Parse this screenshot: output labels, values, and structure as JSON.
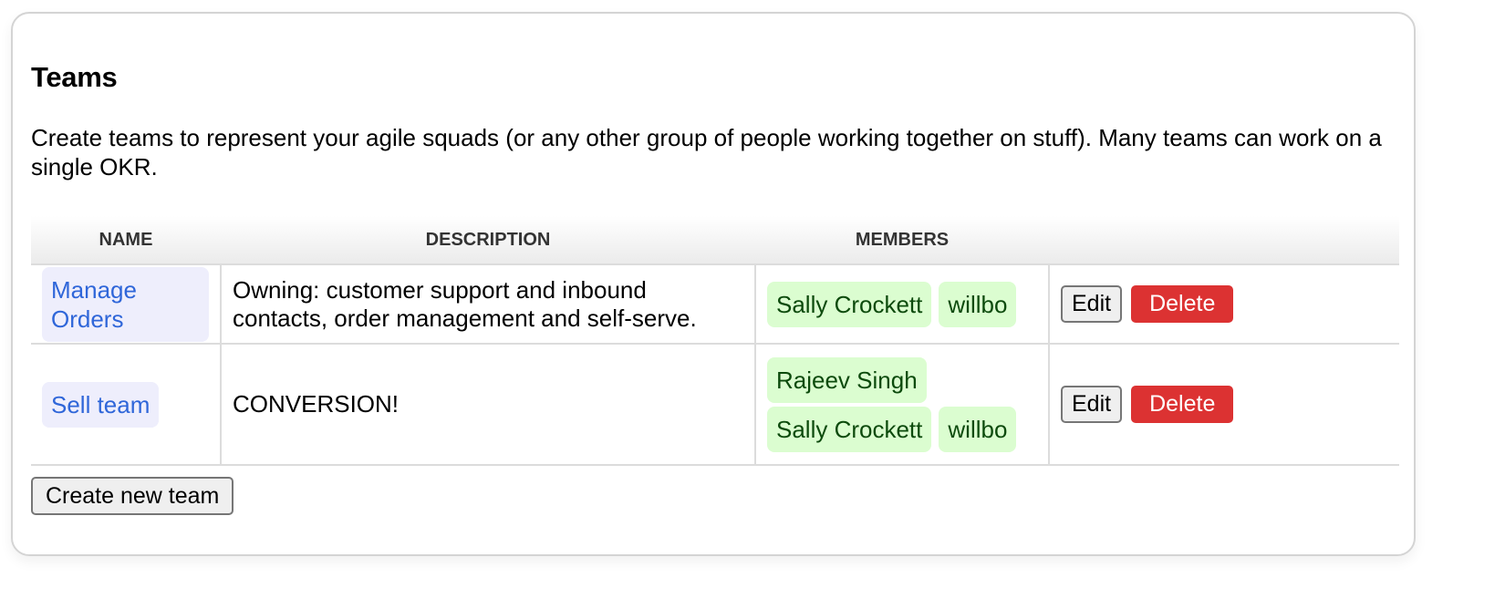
{
  "page": {
    "title": "Teams",
    "intro": "Create teams to represent your agile squads (or any other group of people working together on stuff). Many teams can work on a single OKR."
  },
  "table": {
    "headers": {
      "name": "NAME",
      "description": "DESCRIPTION",
      "members": "MEMBERS",
      "actions": ""
    },
    "rows": [
      {
        "name": "Manage Orders",
        "description": "Owning: customer support and inbound contacts, order management and self-serve.",
        "members": [
          "Sally Crockett",
          "willbo"
        ],
        "edit_label": "Edit",
        "delete_label": "Delete"
      },
      {
        "name": "Sell team",
        "description": "CONVERSION!",
        "members": [
          "Rajeev Singh",
          "Sally Crockett",
          "willbo"
        ],
        "edit_label": "Edit",
        "delete_label": "Delete"
      }
    ]
  },
  "actions": {
    "create_label": "Create new team"
  },
  "colors": {
    "team_link": "#2f66d9",
    "team_chip_bg": "#eeeefc",
    "member_chip_bg": "#dbfdd0",
    "member_text": "#0c4a0c",
    "delete_bg": "#dc3232"
  }
}
